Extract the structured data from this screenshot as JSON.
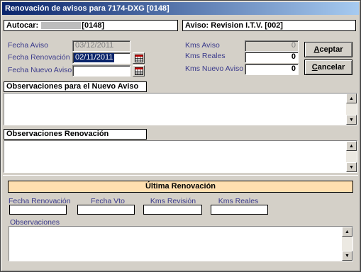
{
  "window": {
    "title": "Renovación de avisos para 7174-DXG [0148]"
  },
  "header": {
    "autocar_label": "Autocar:",
    "autocar_value": "[0148]",
    "aviso_label": "Aviso:",
    "aviso_value": "Revision I.T.V. [002]"
  },
  "form": {
    "fecha_aviso_label": "Fecha Aviso",
    "fecha_aviso_value": "03/12/2011",
    "fecha_renovacion_label": "Fecha Renovación",
    "fecha_renovacion_value": "02/11/2011",
    "fecha_nuevo_aviso_label": "Fecha Nuevo Aviso",
    "fecha_nuevo_aviso_value": "",
    "kms_aviso_label": "Kms Aviso",
    "kms_aviso_value": "0",
    "kms_reales_label": "Kms Reales",
    "kms_reales_value": "0",
    "kms_nuevo_aviso_label": "Kms Nuevo Aviso",
    "kms_nuevo_aviso_value": "0"
  },
  "buttons": {
    "aceptar_first": "A",
    "aceptar_rest": "ceptar",
    "cancelar_first": "C",
    "cancelar_rest": "ancelar"
  },
  "sections": {
    "obs_nuevo_aviso": "Observaciones para el Nuevo Aviso",
    "obs_renovacion": "Observaciones Renovación"
  },
  "ultima": {
    "title": "Última Renovación",
    "fecha_renovacion_label": "Fecha Renovación",
    "fecha_vto_label": "Fecha Vto",
    "kms_revision_label": "Kms Revisión",
    "kms_reales_label": "Kms Reales",
    "observaciones_label": "Observaciones"
  },
  "colors": {
    "title_bar": "#0a246a",
    "banner": "#ffdfb0",
    "label": "#3b3b8c"
  },
  "icons": {
    "calendar": "calendar-icon",
    "scroll_up": "scroll-up-arrow-icon",
    "scroll_down": "scroll-down-arrow-icon"
  }
}
